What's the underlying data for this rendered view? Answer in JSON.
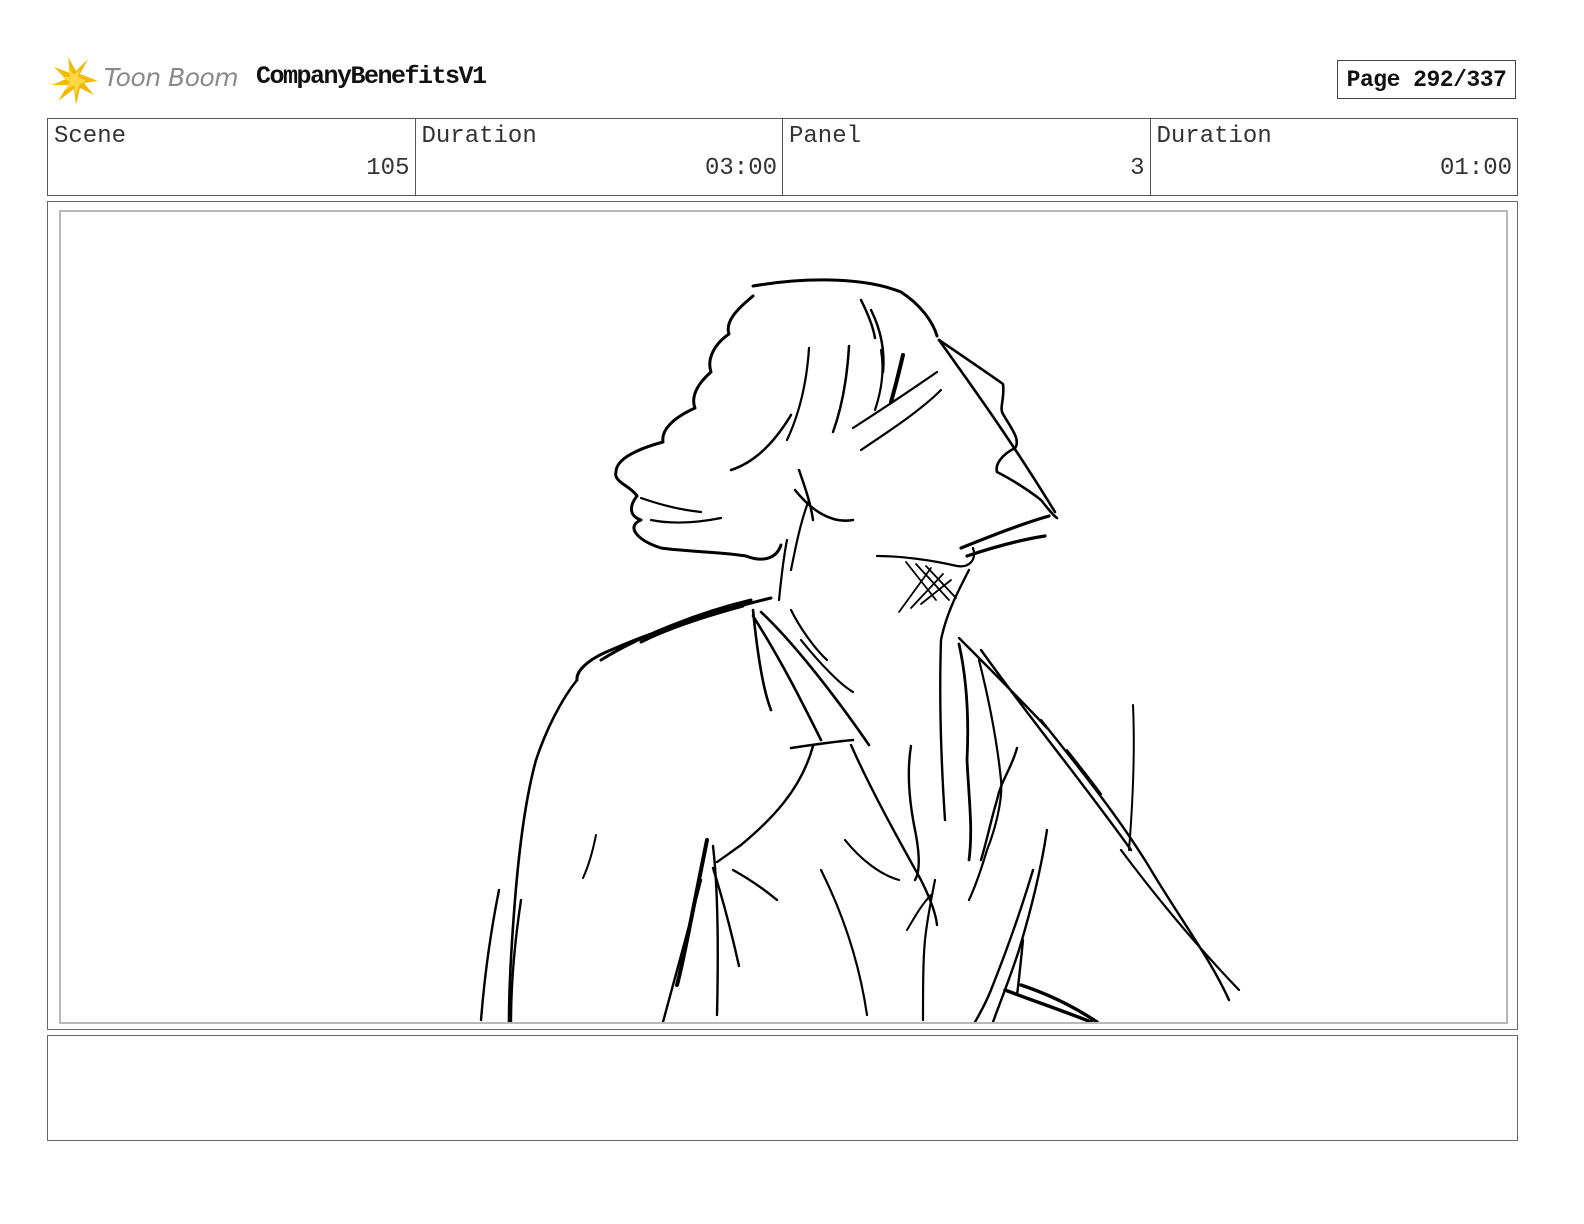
{
  "header": {
    "logo_text": "Toon Boom",
    "project_title": "CompanyBenefitsV1",
    "page_label": "Page 292/337"
  },
  "info": {
    "scene_label": "Scene",
    "scene_value": "105",
    "scene_duration_label": "Duration",
    "scene_duration_value": "03:00",
    "panel_label": "Panel",
    "panel_value": "3",
    "panel_duration_label": "Duration",
    "panel_duration_value": "01:00"
  },
  "notes": {
    "text": ""
  },
  "colors": {
    "logo_accent": "#f5b800",
    "border": "#555555"
  },
  "icons": {
    "logo": "toon-boom-star-icon"
  }
}
